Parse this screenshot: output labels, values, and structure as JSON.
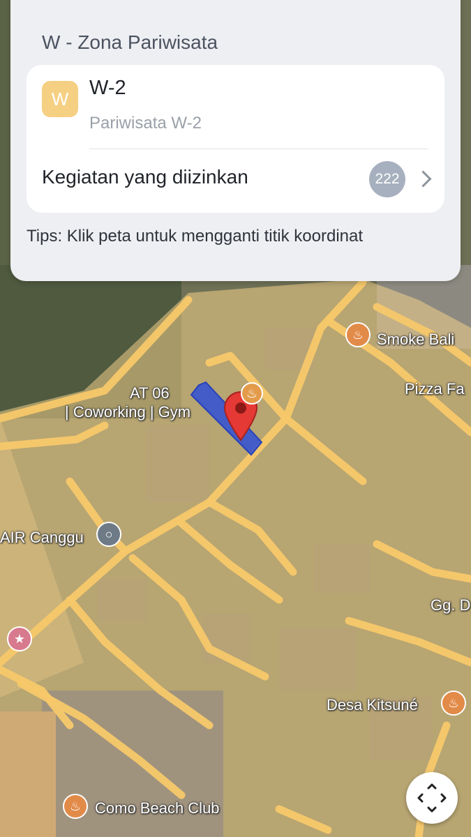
{
  "panel": {
    "zone_title": "W - Zona Pariwisata",
    "badge_letter": "W",
    "zone_code": "W-2",
    "zone_description": "Pariwisata W-2",
    "activities_label": "Kegiatan yang diizinkan",
    "activities_count": "222",
    "tips": "Tips: Klik peta untuk mengganti titik koordinat"
  },
  "map": {
    "labels": {
      "at06": "AT 06",
      "coworking": "| Coworking | Gym",
      "smoke": "Smoke Bali",
      "pizza": "Pizza Fa",
      "air_canggu": "AIR Canggu",
      "gg_d": "Gg. D",
      "desa_kitsune": "Desa Kitsuné",
      "como": "Como Beach Club"
    },
    "colors": {
      "zone_overlay": "#f2cf8a",
      "road": "#f7c86a",
      "selected_parcel": "#2f4fd6",
      "marker": "#e53935"
    },
    "icons": [
      "restaurant-icon",
      "location-pin-icon",
      "recenter-icon"
    ]
  }
}
